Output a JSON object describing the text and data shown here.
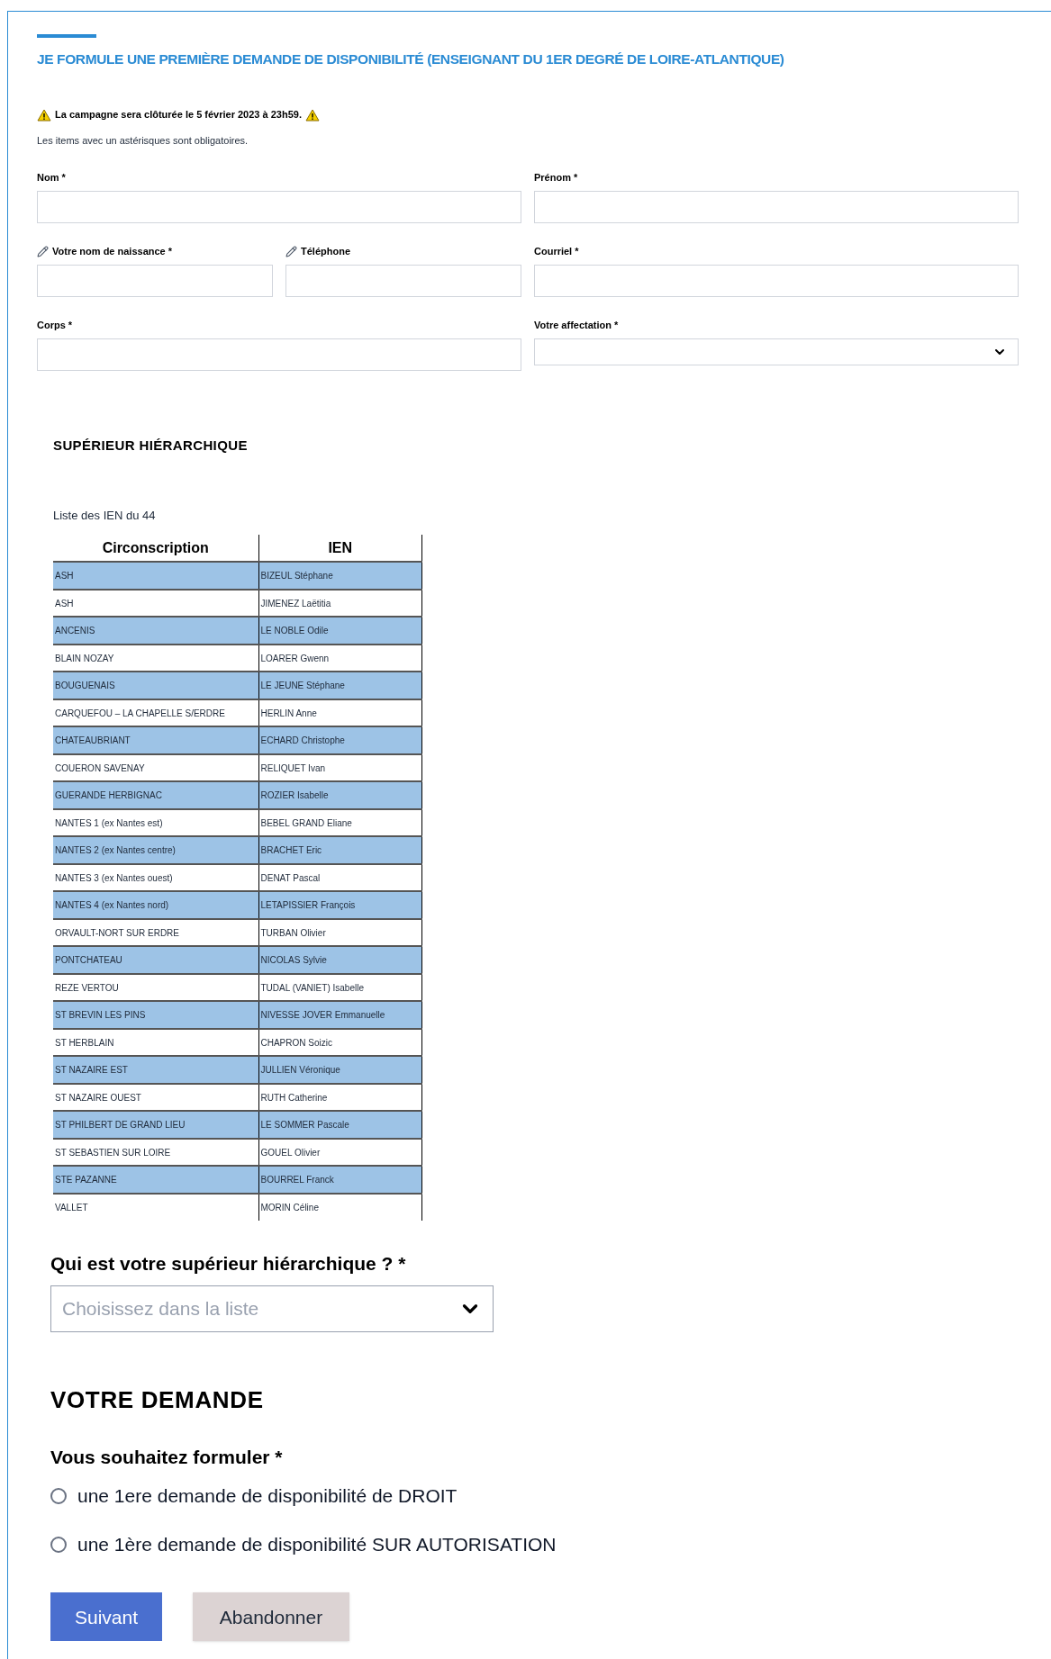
{
  "title": "JE FORMULE UNE PREMIÈRE DEMANDE DE DISPONIBILITÉ (ENSEIGNANT DU 1ER DEGRÉ DE LOIRE-ATLANTIQUE)",
  "warning": "La campagne sera clôturée le 5 février 2023 à 23h59.",
  "note": "Les items avec un astérisques sont obligatoires.",
  "field_rows": [
    [
      {
        "label": "Nom *",
        "kind": "text"
      },
      {
        "label": "Prénom *",
        "kind": "text"
      }
    ],
    [
      {
        "label": "Votre nom de naissance *",
        "kind": "pencil_text"
      },
      {
        "label": "Téléphone",
        "kind": "pencil_text"
      },
      {
        "label": "Courriel *",
        "kind": "text"
      }
    ],
    [
      {
        "label": "Corps *",
        "kind": "text"
      },
      {
        "label": "Votre affectation *",
        "kind": "select"
      }
    ]
  ],
  "superior": {
    "heading": "SUPÉRIEUR HIÉRARCHIQUE",
    "caption": "Liste des IEN du 44",
    "table": {
      "columns": [
        "Circonscription",
        "IEN"
      ],
      "rows": [
        {
          "cells": [
            "ASH",
            "BIZEUL Stéphane"
          ],
          "color": "#9dc3e6"
        },
        {
          "cells": [
            "ASH",
            "JIMENEZ Laëtitia"
          ],
          "color": "#ffffff"
        },
        {
          "cells": [
            "ANCENIS",
            "LE NOBLE Odile"
          ],
          "color": "#9dc3e6"
        },
        {
          "cells": [
            "BLAIN NOZAY",
            "LOARER Gwenn"
          ],
          "color": "#ffffff"
        },
        {
          "cells": [
            "BOUGUENAIS",
            "LE JEUNE Stéphane"
          ],
          "color": "#9dc3e6"
        },
        {
          "cells": [
            "CARQUEFOU – LA CHAPELLE S/ERDRE",
            "HERLIN Anne"
          ],
          "color": "#ffffff"
        },
        {
          "cells": [
            "CHATEAUBRIANT",
            "ECHARD Christophe"
          ],
          "color": "#9dc3e6"
        },
        {
          "cells": [
            "COUERON SAVENAY",
            "RELIQUET Ivan"
          ],
          "color": "#ffffff"
        },
        {
          "cells": [
            "GUERANDE HERBIGNAC",
            "ROZIER Isabelle"
          ],
          "color": "#9dc3e6"
        },
        {
          "cells": [
            "NANTES 1 (ex Nantes est)",
            "BEBEL GRAND Eliane"
          ],
          "color": "#ffffff"
        },
        {
          "cells": [
            "NANTES 2 (ex Nantes centre)",
            "BRACHET Eric"
          ],
          "color": "#9dc3e6"
        },
        {
          "cells": [
            "NANTES 3 (ex Nantes ouest)",
            "DENAT Pascal"
          ],
          "color": "#ffffff"
        },
        {
          "cells": [
            "NANTES 4 (ex Nantes nord)",
            "LETAPISSIER François"
          ],
          "color": "#9dc3e6"
        },
        {
          "cells": [
            "ORVAULT-NORT SUR ERDRE",
            "TURBAN Olivier"
          ],
          "color": "#ffffff"
        },
        {
          "cells": [
            "PONTCHATEAU",
            "NICOLAS Sylvie"
          ],
          "color": "#9dc3e6"
        },
        {
          "cells": [
            "REZE VERTOU",
            "TUDAL (VANIET) Isabelle"
          ],
          "color": "#ffffff"
        },
        {
          "cells": [
            "ST BREVIN LES PINS",
            "NIVESSE JOVER Emmanuelle"
          ],
          "color": "#9dc3e6"
        },
        {
          "cells": [
            "ST HERBLAIN",
            "CHAPRON Soizic"
          ],
          "color": "#ffffff"
        },
        {
          "cells": [
            "ST NAZAIRE EST",
            "JULLIEN Véronique"
          ],
          "color": "#9dc3e6"
        },
        {
          "cells": [
            "ST NAZAIRE OUEST",
            "RUTH Catherine"
          ],
          "color": "#ffffff"
        },
        {
          "cells": [
            "ST PHILBERT DE GRAND LIEU",
            "LE SOMMER Pascale"
          ],
          "color": "#9dc3e6"
        },
        {
          "cells": [
            "ST SEBASTIEN SUR LOIRE",
            "GOUEL Olivier"
          ],
          "color": "#ffffff"
        },
        {
          "cells": [
            "STE PAZANNE",
            "BOURREL Franck"
          ],
          "color": "#9dc3e6"
        },
        {
          "cells": [
            "VALLET",
            "MORIN Céline"
          ],
          "color": "#ffffff"
        }
      ]
    },
    "question": "Qui est votre supérieur hiérarchique ? *",
    "select": {
      "placeholder": "Choisissez dans la liste"
    }
  },
  "request": {
    "heading": "VOTRE DEMANDE",
    "question": "Vous souhaitez formuler *",
    "options": [
      {
        "label": "une 1ere demande de disponibilité de DROIT",
        "selected": false
      },
      {
        "label": "une 1ère demande de disponibilité SUR AUTORISATION",
        "selected": false
      }
    ]
  },
  "buttons": [
    {
      "label": "Suivant",
      "kind": "primary"
    },
    {
      "label": "Abandonner",
      "kind": "secondary"
    }
  ]
}
